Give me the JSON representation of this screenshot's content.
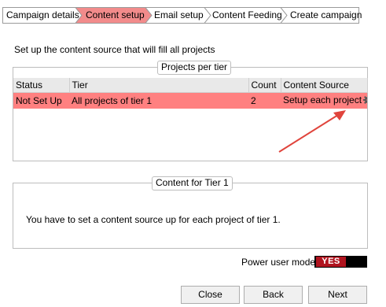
{
  "wizard": {
    "steps": [
      {
        "label": "Campaign details",
        "state": "done"
      },
      {
        "label": "Content setup",
        "state": "active"
      },
      {
        "label": "Email setup",
        "state": "pending"
      },
      {
        "label": "Content Feeding",
        "state": "pending"
      },
      {
        "label": "Create campaign",
        "state": "pending"
      }
    ],
    "colors": {
      "active": "#f28b8b",
      "inactive": "#ffffff",
      "border": "#9a9a9a"
    }
  },
  "intro_text": "Set up the content source that will fill all projects",
  "projects_per_tier": {
    "title": "Projects per tier",
    "columns": [
      "Status",
      "Tier",
      "Count",
      "Content Source"
    ],
    "rows": [
      {
        "status": "Not Set Up",
        "tier": "All projects of tier 1",
        "count": "2",
        "content_source": "Setup each project",
        "icon": "gear-icon",
        "selected": true
      }
    ],
    "selected_row_color": "#ff8080"
  },
  "annotation": {
    "icon": "red-arrow",
    "color": "#e0443c"
  },
  "content_for_tier": {
    "title": "Content for Tier 1",
    "message": "You have to set a content source up for each project of tier 1."
  },
  "power_user_mode": {
    "label": "Power user mode",
    "value": "YES",
    "on_color": "#b0141f"
  },
  "buttons": {
    "close": "Close",
    "back": "Back",
    "next": "Next"
  }
}
